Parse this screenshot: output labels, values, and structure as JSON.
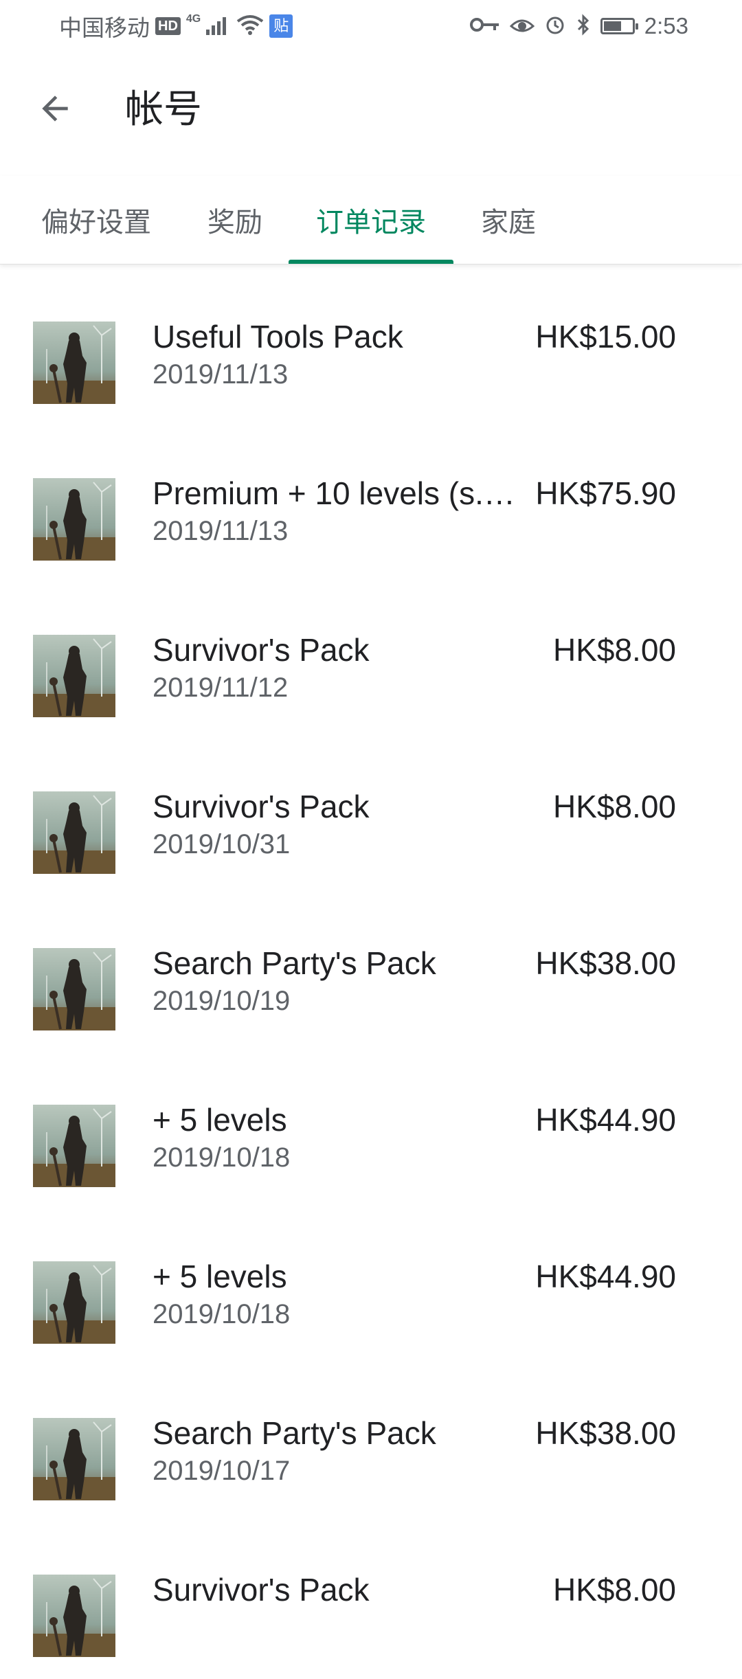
{
  "status_bar": {
    "carrier": "中国移动",
    "hd_badge": "HD",
    "network": "4G",
    "app_badge": "贴",
    "time": "2:53"
  },
  "app_bar": {
    "title": "帐号",
    "back_icon": "arrow-left-icon"
  },
  "tabs": [
    {
      "label": "偏好设置"
    },
    {
      "label": "奖励"
    },
    {
      "label": "订单记录",
      "active": true
    },
    {
      "label": "家庭"
    }
  ],
  "colors": {
    "accent": "#01875f",
    "primary_text": "#202124",
    "secondary_text": "#5f6368"
  },
  "orders": [
    {
      "title": "Useful Tools Pack",
      "date": "2019/11/13",
      "price": "HK$15.00"
    },
    {
      "title": "Premium + 10 levels (s.…",
      "date": "2019/11/13",
      "price": "HK$75.90"
    },
    {
      "title": "Survivor's Pack",
      "date": "2019/11/12",
      "price": "HK$8.00"
    },
    {
      "title": "Survivor's Pack",
      "date": "2019/10/31",
      "price": "HK$8.00"
    },
    {
      "title": "Search Party's Pack",
      "date": "2019/10/19",
      "price": "HK$38.00"
    },
    {
      "title": " + 5 levels",
      "date": "2019/10/18",
      "price": "HK$44.90"
    },
    {
      "title": " + 5 levels",
      "date": "2019/10/18",
      "price": "HK$44.90"
    },
    {
      "title": "Search Party's Pack",
      "date": "2019/10/17",
      "price": "HK$38.00"
    },
    {
      "title": "Survivor's Pack",
      "date": "",
      "price": "HK$8.00"
    }
  ]
}
